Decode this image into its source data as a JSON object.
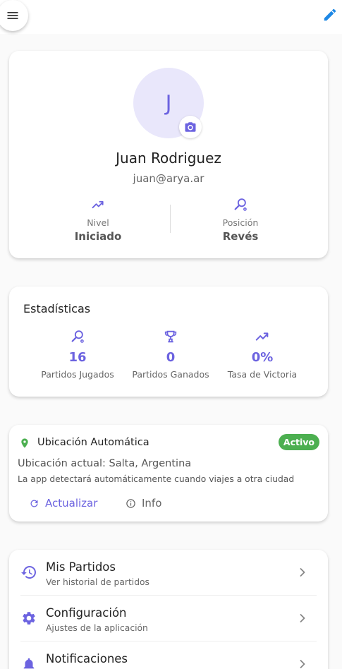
{
  "profile": {
    "initial": "J",
    "name": "Juan Rodriguez",
    "email": "juan@arya.ar",
    "level_label": "Nivel",
    "level_value": "Iniciado",
    "position_label": "Posición",
    "position_value": "Revés"
  },
  "stats": {
    "title": "Estadísticas",
    "items": [
      {
        "value": "16",
        "label": "Partidos Jugados",
        "icon": "racket-icon"
      },
      {
        "value": "0",
        "label": "Partidos Ganados",
        "icon": "trophy-icon"
      },
      {
        "value": "0%",
        "label": "Tasa de Victoria",
        "icon": "trending-up-icon"
      }
    ]
  },
  "location": {
    "title": "Ubicación Automática",
    "badge": "Activo",
    "current": "Ubicación actual: Salta, Argentina",
    "description": "La app detectará automáticamente cuando viajes a otra ciudad",
    "refresh_label": "Actualizar",
    "info_label": "Info"
  },
  "menu": {
    "items": [
      {
        "title": "Mis Partidos",
        "subtitle": "Ver historial de partidos",
        "icon": "history-icon"
      },
      {
        "title": "Configuración",
        "subtitle": "Ajustes de la aplicación",
        "icon": "gear-icon"
      },
      {
        "title": "Notificaciones",
        "subtitle": "",
        "icon": "bell-icon"
      }
    ]
  },
  "colors": {
    "accent": "#6c63e0",
    "active_badge": "#4caf50",
    "edit_icon": "#1e88e5"
  }
}
